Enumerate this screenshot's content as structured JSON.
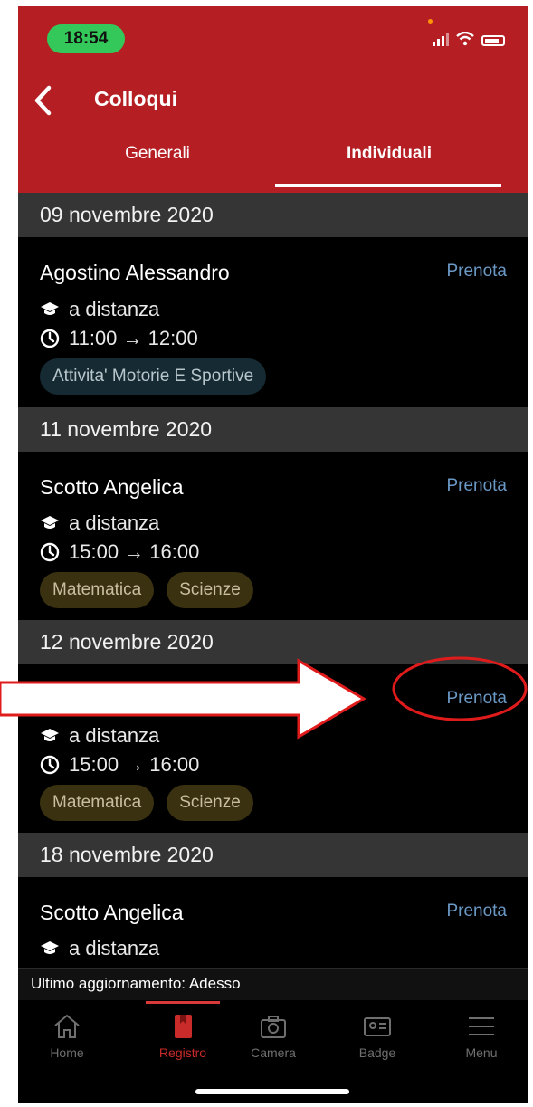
{
  "status_bar": {
    "time": "18:54"
  },
  "header": {
    "title": "Colloqui"
  },
  "tabs": [
    {
      "label": "Generali",
      "active": false
    },
    {
      "label": "Individuali",
      "active": true
    }
  ],
  "sections": [
    {
      "date": "09 novembre 2020",
      "teacher": "Agostino Alessandro",
      "action": "Prenota",
      "mode": "a distanza",
      "time": "11:00 → 12:00",
      "subjects": [
        "Attivita' Motorie E Sportive"
      ]
    },
    {
      "date": "11 novembre 2020",
      "teacher": "Scotto Angelica",
      "action": "Prenota",
      "mode": "a distanza",
      "time": "15:00 → 16:00",
      "subjects": [
        "Matematica",
        "Scienze"
      ]
    },
    {
      "date": "12 novembre 2020",
      "teacher": "",
      "action": "Prenota",
      "mode": "a distanza",
      "time": "15:00 → 16:00",
      "subjects": [
        "Matematica",
        "Scienze"
      ]
    },
    {
      "date": "18 novembre 2020",
      "teacher": "Scotto Angelica",
      "action": "Prenota",
      "mode": "a distanza"
    }
  ],
  "footer": {
    "last_update": "Ultimo aggiornamento: Adesso"
  },
  "tab_bar": [
    {
      "label": "Home",
      "icon": "home-icon"
    },
    {
      "label": "Registro",
      "icon": "book-icon",
      "active": true
    },
    {
      "label": "Camera",
      "icon": "camera-icon"
    },
    {
      "label": "Badge",
      "icon": "badge-icon"
    },
    {
      "label": "Menu",
      "icon": "menu-icon"
    }
  ],
  "colors": {
    "header_red": "#b51f24",
    "link_blue": "#6a99c6",
    "annotation_red": "#e01b1b"
  }
}
